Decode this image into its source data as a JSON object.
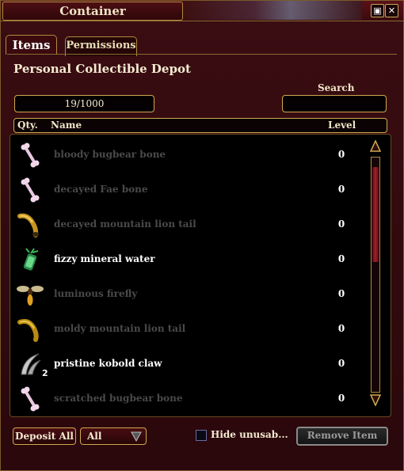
{
  "window": {
    "title": "Container"
  },
  "tabs": [
    {
      "label": "Items",
      "active": true
    },
    {
      "label": "Permissions",
      "active": false
    }
  ],
  "depot": {
    "title": "Personal Collectible Depot",
    "capacity": "19/1000",
    "search_label": "Search",
    "search_value": ""
  },
  "columns": {
    "qty": "Qty.",
    "name": "Name",
    "level": "Level"
  },
  "items": [
    {
      "name": "bloody bugbear bone",
      "level": "0",
      "qty": "",
      "usable": false,
      "icon": "bone-icon"
    },
    {
      "name": "decayed Fae bone",
      "level": "0",
      "qty": "",
      "usable": false,
      "icon": "bone-icon"
    },
    {
      "name": "decayed mountain lion tail",
      "level": "0",
      "qty": "",
      "usable": false,
      "icon": "tail-icon"
    },
    {
      "name": "fizzy mineral water",
      "level": "0",
      "qty": "",
      "usable": true,
      "icon": "potion-icon"
    },
    {
      "name": "luminous firefly",
      "level": "0",
      "qty": "",
      "usable": false,
      "icon": "firefly-icon"
    },
    {
      "name": "moldy mountain lion tail",
      "level": "0",
      "qty": "",
      "usable": false,
      "icon": "tail-icon"
    },
    {
      "name": "pristine kobold claw",
      "level": "0",
      "qty": "2",
      "usable": true,
      "icon": "claw-icon"
    },
    {
      "name": "scratched bugbear bone",
      "level": "0",
      "qty": "",
      "usable": false,
      "icon": "bone-icon"
    }
  ],
  "footer": {
    "deposit_all": "Deposit All",
    "filter_value": "All",
    "hide_unusable": "Hide unusab...",
    "remove_item": "Remove Item"
  },
  "colors": {
    "usable_text": "#ffffff",
    "unusable_text": "#4a4a4a",
    "accent_gold": "#d0a850",
    "panel_red": "#3a0d12"
  }
}
